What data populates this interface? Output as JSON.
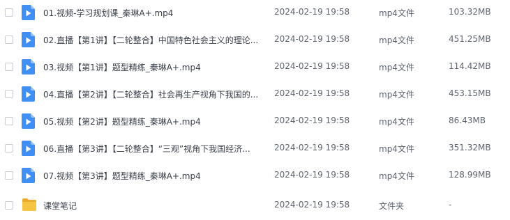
{
  "files": [
    {
      "name": "01.视频-学习规划课_秦琳A+.mp4",
      "date": "2024-02-19 19:58",
      "type": "mp4文件",
      "size": "103.32MB",
      "icon": "video-file-icon"
    },
    {
      "name": "02.直播【第1讲】【二轮整合】中国特色社会主义的理论...",
      "date": "2024-02-19 19:58",
      "type": "mp4文件",
      "size": "451.25MB",
      "icon": "video-file-icon"
    },
    {
      "name": "03.视频【第1讲】题型精练_秦琳A+.mp4",
      "date": "2024-02-19 19:58",
      "type": "mp4文件",
      "size": "114.42MB",
      "icon": "video-file-icon"
    },
    {
      "name": "04.直播【第2讲】【二轮整合】社会再生产视角下我国的...",
      "date": "2024-02-19 19:58",
      "type": "mp4文件",
      "size": "453.15MB",
      "icon": "video-file-icon"
    },
    {
      "name": "05.视频【第2讲】题型精练_秦琳A+.mp4",
      "date": "2024-02-19 19:58",
      "type": "mp4文件",
      "size": "86.43MB",
      "icon": "video-file-icon"
    },
    {
      "name": "06.直播【第3讲】【二轮整合】“三观”视角下我国经济...",
      "date": "2024-02-19 19:58",
      "type": "mp4文件",
      "size": "351.32MB",
      "icon": "video-file-icon"
    },
    {
      "name": "07.视频【第3讲】题型精练_秦琳A+.mp4",
      "date": "2024-02-19 19:58",
      "type": "mp4文件",
      "size": "128.99MB",
      "icon": "video-file-icon"
    },
    {
      "name": "课堂笔记",
      "date": "2024-02-19 19:58",
      "type": "文件夹",
      "size": "-",
      "icon": "folder-icon"
    }
  ],
  "colors": {
    "video_icon": "#3f8ff4",
    "folder_icon": "#f5c443",
    "text_primary": "#3b404a",
    "text_secondary": "#5e6470"
  }
}
